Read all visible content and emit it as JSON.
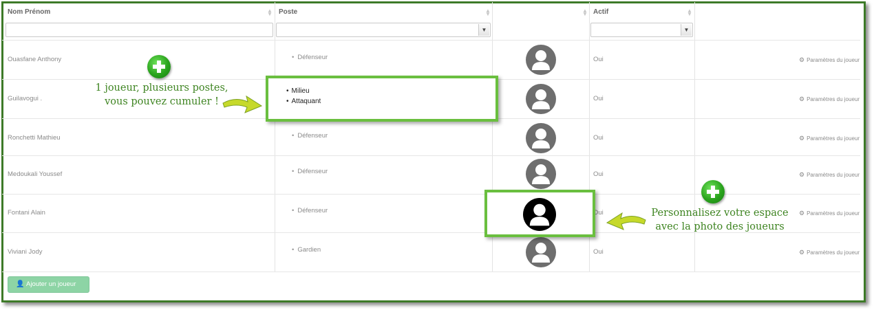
{
  "table": {
    "headers": {
      "name": "Nom Prénom",
      "poste": "Poste",
      "actif": "Actif"
    },
    "sort_icon": "sort-icon",
    "rows": [
      {
        "name": "Ouasfane Anthony",
        "postes": [
          "Défenseur"
        ],
        "actif": "Oui",
        "settings": "Paramètres du joueur"
      },
      {
        "name": "Guilavogui .",
        "postes": [
          "Milieu",
          "Attaquant"
        ],
        "actif": "Oui",
        "settings": "Paramètres du joueur"
      },
      {
        "name": "Ronchetti Mathieu",
        "postes": [
          "Défenseur"
        ],
        "actif": "Oui",
        "settings": "Paramètres du joueur"
      },
      {
        "name": "Medoukali Youssef",
        "postes": [
          "Défenseur"
        ],
        "actif": "Oui",
        "settings": "Paramètres du joueur"
      },
      {
        "name": "Fontani Alain",
        "postes": [
          "Défenseur"
        ],
        "actif": "Oui",
        "settings": "Paramètres du joueur"
      },
      {
        "name": "Viviani Jody",
        "postes": [
          "Gardien"
        ],
        "actif": "Oui",
        "settings": "Paramètres du joueur"
      }
    ]
  },
  "add_button": {
    "label": "Ajouter un joueur",
    "icon": "add-user-icon"
  },
  "callouts": {
    "postes": {
      "line1": "1 joueur, plusieurs postes,",
      "line2": "vous pouvez cumuler !"
    },
    "photo": {
      "line1": "Personnalisez votre espace",
      "line2": "avec la photo des joueurs"
    }
  },
  "colors": {
    "frame": "#3d7a28",
    "highlight": "#6abf3f",
    "callout_text": "#3e8421",
    "button": "#8dd4a5"
  }
}
